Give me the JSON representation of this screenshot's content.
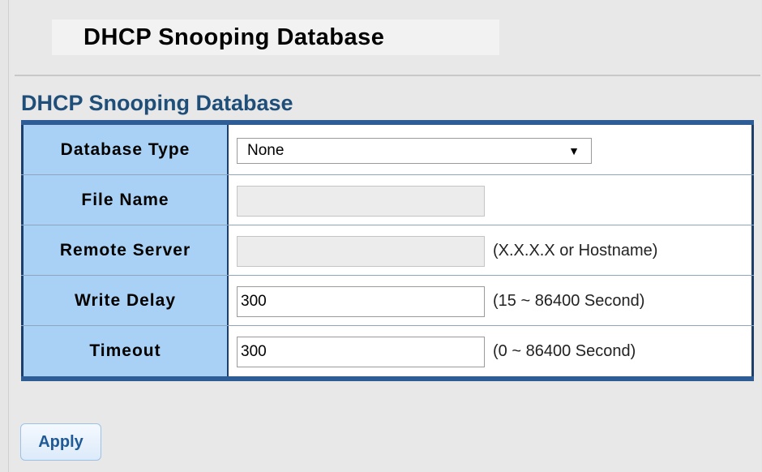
{
  "page": {
    "title": "DHCP Snooping Database"
  },
  "section": {
    "heading": "DHCP Snooping Database"
  },
  "form": {
    "database_type": {
      "label": "Database Type",
      "value": "None"
    },
    "file_name": {
      "label": "File Name",
      "value": ""
    },
    "remote_server": {
      "label": "Remote Server",
      "value": "",
      "hint": "(X.X.X.X or Hostname)"
    },
    "write_delay": {
      "label": "Write Delay",
      "value": "300",
      "hint": "(15 ~ 86400 Second)"
    },
    "timeout": {
      "label": "Timeout",
      "value": "300",
      "hint": "(0 ~ 86400 Second)"
    }
  },
  "actions": {
    "apply_label": "Apply"
  },
  "colors": {
    "label_cell_bg": "#a9d1f5",
    "table_border": "#2e5d96",
    "heading_text": "#1f4e79",
    "apply_text": "#1f5a96"
  }
}
